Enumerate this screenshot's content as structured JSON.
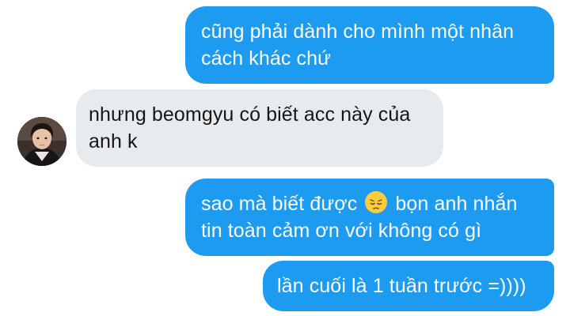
{
  "messages": [
    {
      "direction": "outgoing",
      "lines": [
        "cũng phải dành cho mình một nhân",
        "cách khác chứ"
      ]
    },
    {
      "direction": "incoming",
      "lines": [
        "nhưng beomgyu có biết acc này của",
        "anh k"
      ]
    },
    {
      "direction": "outgoing",
      "line1_before": "sao mà biết được",
      "emoji": "pensive-face",
      "line1_after": "bọn anh nhắn",
      "line2": "tin toàn cảm ơn với không có gì"
    },
    {
      "direction": "outgoing",
      "lines": [
        "lần cuối là 1 tuần trước =))))"
      ]
    }
  ],
  "colors": {
    "outgoing_bubble": "#1d9bf0",
    "incoming_bubble": "#e8ebee",
    "outgoing_text": "#ffffff",
    "incoming_text": "#161616"
  }
}
